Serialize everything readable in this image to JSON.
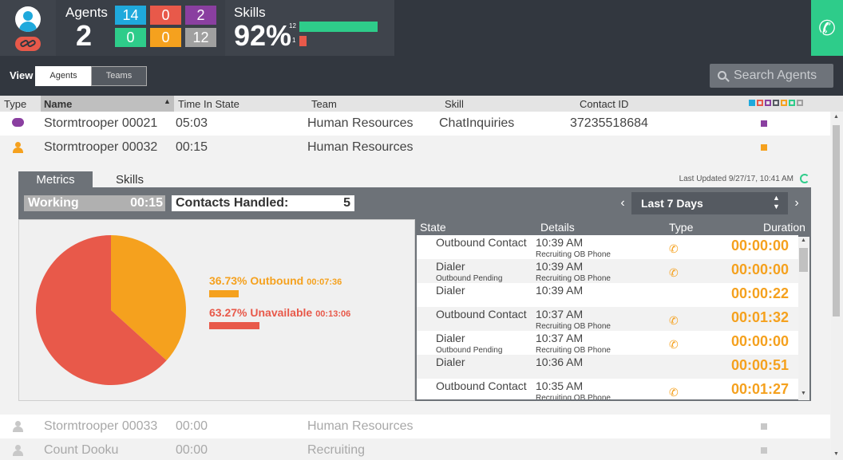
{
  "header": {
    "agents_label": "Agents",
    "agents_count": "2",
    "state_tiles": [
      {
        "value": "14",
        "color": "#1fa9dc"
      },
      {
        "value": "0",
        "color": "#e8594a"
      },
      {
        "value": "2",
        "color": "#8a3fa0"
      },
      {
        "value": "0",
        "color": "#2ecc8a"
      },
      {
        "value": "0",
        "color": "#f5a11e"
      },
      {
        "value": "12",
        "color": "#a0a0a0"
      }
    ],
    "skills_label": "Skills",
    "skills_percent": "92%",
    "skill_bars": [
      {
        "number": "12",
        "fraction": 1.0,
        "color": "#2ecc8a"
      },
      {
        "number": "1",
        "fraction": 0.09,
        "color": "#e8594a"
      }
    ],
    "phone_icon": "phone-icon"
  },
  "view": {
    "label": "View",
    "options": [
      "Agents",
      "Teams"
    ],
    "selected": "Agents",
    "search_placeholder": "Search Agents"
  },
  "columns": [
    "Type",
    "Name",
    "Time In State",
    "Team",
    "Skill",
    "Contact ID"
  ],
  "filter_colors": [
    "#1fa9dc",
    "#e8594a",
    "#8a3fa0",
    "#555a61",
    "#f5a11e",
    "#2ecc8a",
    "#a0a0a0"
  ],
  "rows": [
    {
      "icon": "chat-icon",
      "icon_color": "#8a3fa0",
      "name": "Stormtrooper 00021",
      "time": "05:03",
      "team": "Human Resources",
      "skill": "ChatInquiries",
      "contact_id": "37235518684",
      "status_color": "#8a3fa0"
    },
    {
      "icon": "agent-icon",
      "icon_color": "#f5a11e",
      "name": "Stormtrooper 00032",
      "time": "00:15",
      "team": "Human Resources",
      "skill": "",
      "contact_id": "",
      "status_color": "#f5a11e"
    },
    {
      "icon": "agent-icon",
      "icon_color": "#c8c8c8",
      "name": "Stormtrooper 00033",
      "time": "00:00",
      "team": "Human Resources",
      "skill": "",
      "contact_id": "",
      "status_color": "#c8c8c8"
    },
    {
      "icon": "agent-icon",
      "icon_color": "#c8c8c8",
      "name": "Count Dooku",
      "time": "00:00",
      "team": "Recruiting",
      "skill": "",
      "contact_id": "",
      "status_color": "#c8c8c8"
    }
  ],
  "detail": {
    "tabs": [
      "Metrics",
      "Skills"
    ],
    "active_tab": "Metrics",
    "last_updated": "Last Updated 9/27/17, 10:41 AM",
    "state": "Working",
    "state_time": "00:15",
    "contacts_label": "Contacts Handled:",
    "contacts_value": "5",
    "range": "Last 7 Days",
    "pie": [
      {
        "percent": 36.73,
        "label": "36.73% Outbound",
        "time": "00:07:36",
        "color": "#f5a11e"
      },
      {
        "percent": 63.27,
        "label": "63.27% Unavailable",
        "time": "00:13:06",
        "color": "#e8594a"
      }
    ],
    "table_headers": [
      "State",
      "Details",
      "Type",
      "Duration"
    ],
    "table_rows": [
      {
        "state": "Outbound Contact",
        "state_sub": "",
        "detail": "10:39 AM",
        "detail_sub": "Recruiting OB Phone",
        "phone": true,
        "duration": "00:00:00"
      },
      {
        "state": "Dialer",
        "state_sub": "Outbound Pending",
        "detail": "10:39 AM",
        "detail_sub": "Recruiting OB Phone",
        "phone": true,
        "duration": "00:00:00"
      },
      {
        "state": "Dialer",
        "state_sub": "",
        "detail": "10:39 AM",
        "detail_sub": "",
        "phone": false,
        "duration": "00:00:22"
      },
      {
        "state": "Outbound Contact",
        "state_sub": "",
        "detail": "10:37 AM",
        "detail_sub": "Recruiting OB Phone",
        "phone": true,
        "duration": "00:01:32"
      },
      {
        "state": "Dialer",
        "state_sub": "Outbound Pending",
        "detail": "10:37 AM",
        "detail_sub": "Recruiting OB Phone",
        "phone": true,
        "duration": "00:00:00"
      },
      {
        "state": "Dialer",
        "state_sub": "",
        "detail": "10:36 AM",
        "detail_sub": "",
        "phone": false,
        "duration": "00:00:51"
      },
      {
        "state": "Outbound Contact",
        "state_sub": "",
        "detail": "10:35 AM",
        "detail_sub": "Recruiting OB Phone",
        "phone": true,
        "duration": "00:01:27"
      }
    ]
  }
}
